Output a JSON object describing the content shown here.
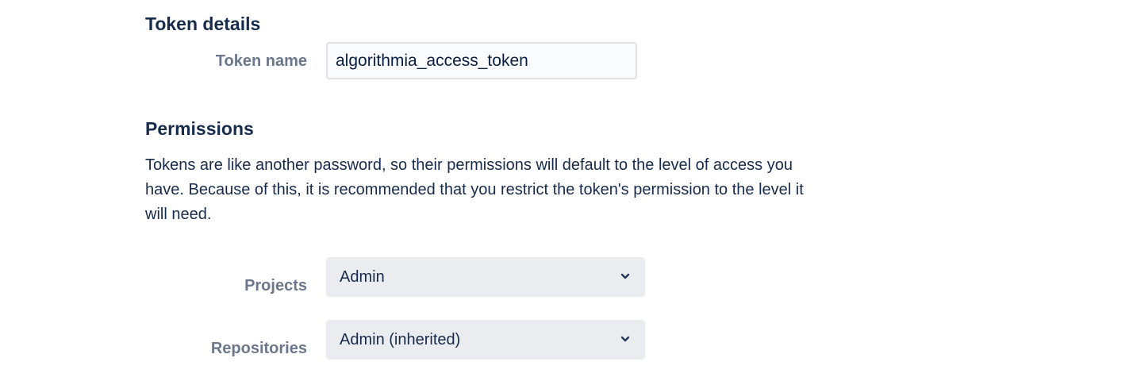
{
  "token_details": {
    "heading": "Token details",
    "token_name_label": "Token name",
    "token_name_value": "algorithmia_access_token"
  },
  "permissions": {
    "heading": "Permissions",
    "description": "Tokens are like another password, so their permissions will default to the level of access you have. Because of this, it is recommended that you restrict the token's permission to the level it will need.",
    "projects": {
      "label": "Projects",
      "selected": "Admin",
      "icon": "chevron-down-icon"
    },
    "repositories": {
      "label": "Repositories",
      "selected": "Admin (inherited)",
      "icon": "chevron-down-icon"
    }
  },
  "colors": {
    "heading_text": "#172b4d",
    "label_text": "#6b778c",
    "input_border": "#dfe1e6",
    "input_background": "#fafbfc",
    "select_background": "#ebecf0"
  }
}
